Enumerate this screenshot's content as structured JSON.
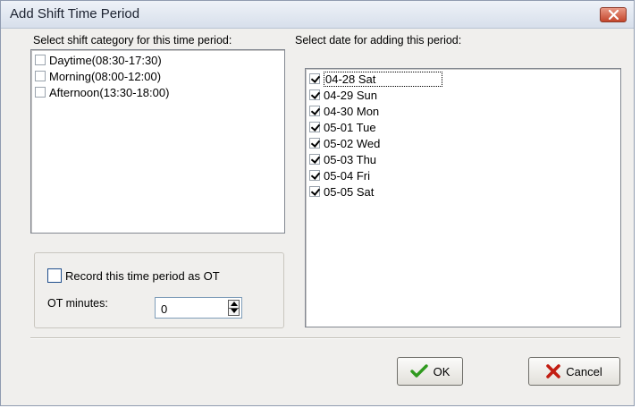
{
  "window": {
    "title": "Add Shift Time Period"
  },
  "left_panel": {
    "heading": "Select shift category for this time period:",
    "categories": [
      {
        "label": "Daytime(08:30-17:30)",
        "checked": false
      },
      {
        "label": "Morning(08:00-12:00)",
        "checked": false
      },
      {
        "label": "Afternoon(13:30-18:00)",
        "checked": false
      }
    ]
  },
  "right_panel": {
    "heading": "Select date for adding this period:",
    "dates": [
      {
        "label": "04-28 Sat",
        "checked": true
      },
      {
        "label": "04-29 Sun",
        "checked": true
      },
      {
        "label": "04-30 Mon",
        "checked": true
      },
      {
        "label": "05-01 Tue",
        "checked": true
      },
      {
        "label": "05-02 Wed",
        "checked": true
      },
      {
        "label": "05-03 Thu",
        "checked": true
      },
      {
        "label": "05-04 Fri",
        "checked": true
      },
      {
        "label": "05-05 Sat",
        "checked": true
      }
    ]
  },
  "ot": {
    "checkbox_label": "Record this time period as OT",
    "checked": false,
    "minutes_label": "OT minutes:",
    "minutes_value": "0"
  },
  "buttons": {
    "ok": "OK",
    "cancel": "Cancel"
  },
  "colors": {
    "ok_check": "#2f9a1e",
    "cancel_x": "#c21d12",
    "close_button": "#c4462c"
  },
  "icons": {
    "close": "close-icon",
    "ok": "checkmark-icon",
    "cancel": "x-mark-icon"
  }
}
